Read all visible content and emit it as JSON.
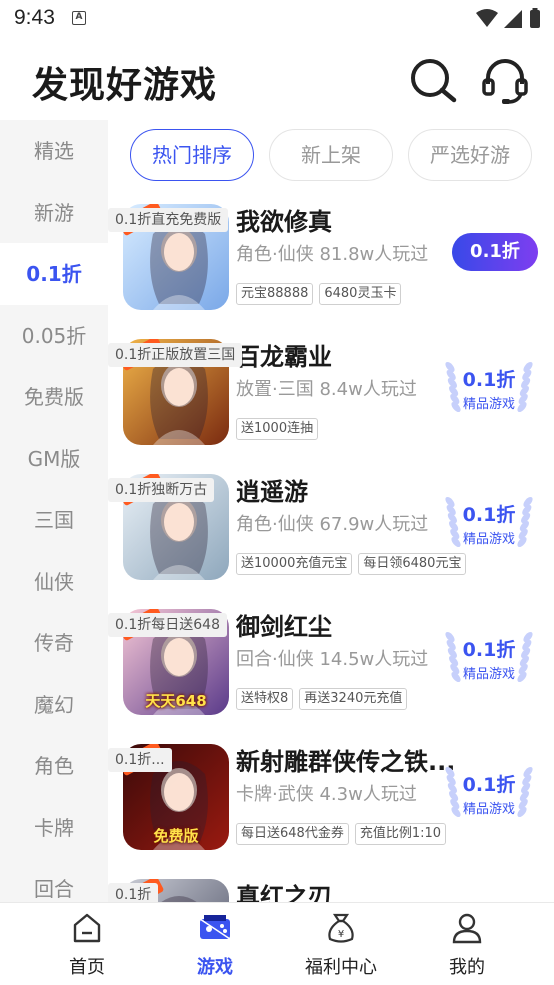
{
  "status_bar": {
    "time": "9:43",
    "notification_glyph": "A"
  },
  "header": {
    "title": "发现好游戏"
  },
  "sidebar": {
    "items": [
      {
        "label": "精选"
      },
      {
        "label": "新游"
      },
      {
        "label": "0.1折",
        "active": true
      },
      {
        "label": "0.05折"
      },
      {
        "label": "免费版"
      },
      {
        "label": "GM版"
      },
      {
        "label": "三国"
      },
      {
        "label": "仙侠"
      },
      {
        "label": "传奇"
      },
      {
        "label": "魔幻"
      },
      {
        "label": "角色"
      },
      {
        "label": "卡牌"
      },
      {
        "label": "回合"
      }
    ]
  },
  "tabs": [
    {
      "label": "热门排序",
      "active": true
    },
    {
      "label": "新上架"
    },
    {
      "label": "严选好游"
    }
  ],
  "games": [
    {
      "name": "我欲修真",
      "tag": "0.1折直充免费版",
      "category": "角色·仙侠",
      "players": "81.8w人玩过",
      "perks": [
        "元宝88888",
        "6480灵玉卡"
      ],
      "discount": "0.1折",
      "discount_style": "pill",
      "icon_badge": "0.1折",
      "icon_label": "",
      "icon_colors": [
        "#d8ecff",
        "#7aa8e8"
      ]
    },
    {
      "name": "百龙霸业",
      "tag": "0.1折正版放置三国",
      "category": "放置·三国",
      "players": "8.4w人玩过",
      "perks": [
        "送1000连抽"
      ],
      "discount": "0.1折",
      "discount_sub": "精品游戏",
      "discount_style": "wreath",
      "icon_badge": "0.1折",
      "icon_label": "",
      "icon_colors": [
        "#f2b64a",
        "#7a2a10"
      ]
    },
    {
      "name": "逍遥游",
      "tag": "0.1折独断万古",
      "category": "角色·仙侠",
      "players": "67.9w人玩过",
      "perks": [
        "送10000充值元宝",
        "每日领6480元宝"
      ],
      "discount": "0.1折",
      "discount_sub": "精品游戏",
      "discount_style": "wreath",
      "icon_badge": "0.1折",
      "icon_label": "",
      "icon_colors": [
        "#e9f0f6",
        "#8ea7bc"
      ]
    },
    {
      "name": "御剑红尘",
      "tag": "0.1折每日送648",
      "category": "回合·仙侠",
      "players": "14.5w人玩过",
      "perks": [
        "送特权8",
        "再送3240元充值"
      ],
      "discount": "0.1折",
      "discount_sub": "精品游戏",
      "discount_style": "wreath",
      "icon_badge": "0.1折",
      "icon_label": "天天648",
      "icon_colors": [
        "#f7c9d6",
        "#5a3a8a"
      ]
    },
    {
      "name": "新射雕群侠传之铁...",
      "tag": "0.1折...",
      "category": "卡牌·武侠",
      "players": "4.3w人玩过",
      "perks": [
        "每日送648代金券",
        "充值比例1:10"
      ],
      "discount": "0.1折",
      "discount_sub": "精品游戏",
      "discount_style": "wreath",
      "icon_badge": "0.1折",
      "icon_label": "免费版",
      "icon_colors": [
        "#3a0a0a",
        "#9a1a10"
      ]
    },
    {
      "name": "真红之刃",
      "tag": "0.1折",
      "category": "",
      "players": "",
      "perks": [],
      "discount": "",
      "discount_style": "none",
      "icon_badge": "0.1折",
      "icon_label": "",
      "icon_colors": [
        "#c9cbd4",
        "#4a4e63"
      ]
    }
  ],
  "bottom_nav": [
    {
      "label": "首页",
      "icon": "home-icon"
    },
    {
      "label": "游戏",
      "icon": "gamepad-icon",
      "active": true
    },
    {
      "label": "福利中心",
      "icon": "money-bag-icon"
    },
    {
      "label": "我的",
      "icon": "user-icon"
    }
  ],
  "colors": {
    "accent": "#3b54f0",
    "sidebar_bg": "#f5f5f5",
    "pill_gradient_start": "#3849e8",
    "pill_gradient_end": "#7e3ef0"
  }
}
